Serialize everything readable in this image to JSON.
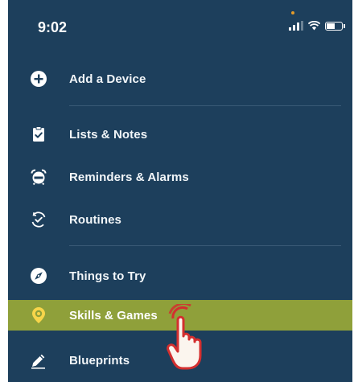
{
  "status_bar": {
    "time": "9:02",
    "icons": [
      "signal-icon",
      "wifi-icon",
      "battery-icon"
    ]
  },
  "menu": {
    "items": [
      {
        "id": "add-device",
        "label": "Add a Device",
        "icon": "plus-circle-icon"
      },
      {
        "id": "lists-notes",
        "label": "Lists & Notes",
        "icon": "clipboard-check-icon"
      },
      {
        "id": "reminders-alarms",
        "label": "Reminders & Alarms",
        "icon": "alarm-clock-icon"
      },
      {
        "id": "routines",
        "label": "Routines",
        "icon": "routines-icon"
      },
      {
        "id": "things-to-try",
        "label": "Things to Try",
        "icon": "compass-icon"
      },
      {
        "id": "skills-games",
        "label": "Skills & Games",
        "icon": "location-pin-icon",
        "active": true
      },
      {
        "id": "blueprints",
        "label": "Blueprints",
        "icon": "pencil-icon"
      }
    ]
  },
  "colors": {
    "background": "#1d3f5c",
    "highlight": "#8fa03a",
    "divider": "#3a5a76",
    "pointer_outline": "#d32f2f"
  }
}
